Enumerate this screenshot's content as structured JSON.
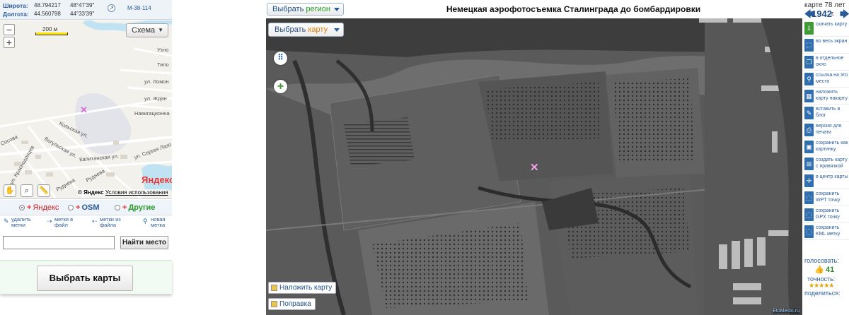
{
  "coords": {
    "lat_label": "Широта:",
    "lat_value": "48.794217",
    "lat_dms": "48°47′39″",
    "lon_label": "Долгота:",
    "lon_value": "44.560798",
    "lon_dms": "44°33′39″",
    "sheet": "M-38-114"
  },
  "minimap": {
    "scale_label": "200 м",
    "zoom_in": "+",
    "zoom_out": "−",
    "schema_label": "Схема",
    "streets": {
      "uzlo": "Узло",
      "tipo": "Типо",
      "lomon": "ул. Ломон",
      "zhdan": "ул. Ждан",
      "navig": "Навигационна",
      "kolsk": "Кольская ул.",
      "voguly": "Вогульская ул.",
      "kapitan": "Капитанская ул.",
      "lazo": "ул. Сергея Лазо",
      "krasnod": "ул. Краснодонцев",
      "rudneva1": "Руднева",
      "rudneva2": "Руднева",
      "sosova": "Сосова"
    },
    "yandex_logo": "Яндекс",
    "copyright": "© Яндекс",
    "terms": "Условия использования"
  },
  "providers": {
    "yandex": "Яндекс",
    "osm": "OSM",
    "others": "Другие"
  },
  "actions": {
    "delete_marks": [
      "удалить",
      "метки"
    ],
    "marks_to_file": [
      "метки в",
      "файл"
    ],
    "marks_from_file": [
      "метки из",
      "файла"
    ],
    "new_mark": [
      "новая",
      "метка"
    ]
  },
  "search": {
    "value": "",
    "button": "Найти место"
  },
  "choose_maps": "Выбрать карты",
  "header": {
    "region_prefix": "Выбрать ",
    "region_word": "регион",
    "title": "Немецкая аэрофотосъемка Сталинграда до бомбардировки"
  },
  "photo": {
    "map_prefix": "Выбрать ",
    "map_word": "карту",
    "overlay_map": "Наложить карту",
    "correction": "Поправка",
    "attribution": "EtoMesto.ru"
  },
  "sidebar": {
    "age_label": "карте 78 лет",
    "year": "1942",
    "year_suffix": "г.",
    "items": [
      {
        "icon": "download-icon",
        "label": "скачать карту",
        "green": true
      },
      {
        "icon": "fullscreen-icon",
        "label": "во весь экран",
        "green": false
      },
      {
        "icon": "window-icon",
        "label": "в отдельное окно",
        "green": false
      },
      {
        "icon": "link-icon",
        "label": "ссылка на это место",
        "green": false
      },
      {
        "icon": "overlay-icon",
        "label": "наложить карту накарту",
        "green": false
      },
      {
        "icon": "blog-icon",
        "label": "вставить в блог",
        "green": false
      },
      {
        "icon": "print-icon",
        "label": "версия для печати",
        "green": false
      },
      {
        "icon": "picture-icon",
        "label": "сохранить как картинку",
        "green": false
      },
      {
        "icon": "georef-icon",
        "label": "создать карту с привязкой",
        "green": false
      },
      {
        "icon": "center-icon",
        "label": "в центр карты",
        "green": false
      },
      {
        "icon": "wpt-icon",
        "label": "сохранить WPT точку",
        "green": false
      },
      {
        "icon": "gpx-icon",
        "label": "сохранить GPX точку",
        "green": false
      },
      {
        "icon": "kml-icon",
        "label": "сохранить KML метку",
        "green": false
      }
    ],
    "vote_label": "голосовать:",
    "vote_count": "41",
    "accuracy_label": "точность:",
    "stars": "★★★★★",
    "share_label": "поделиться:"
  }
}
